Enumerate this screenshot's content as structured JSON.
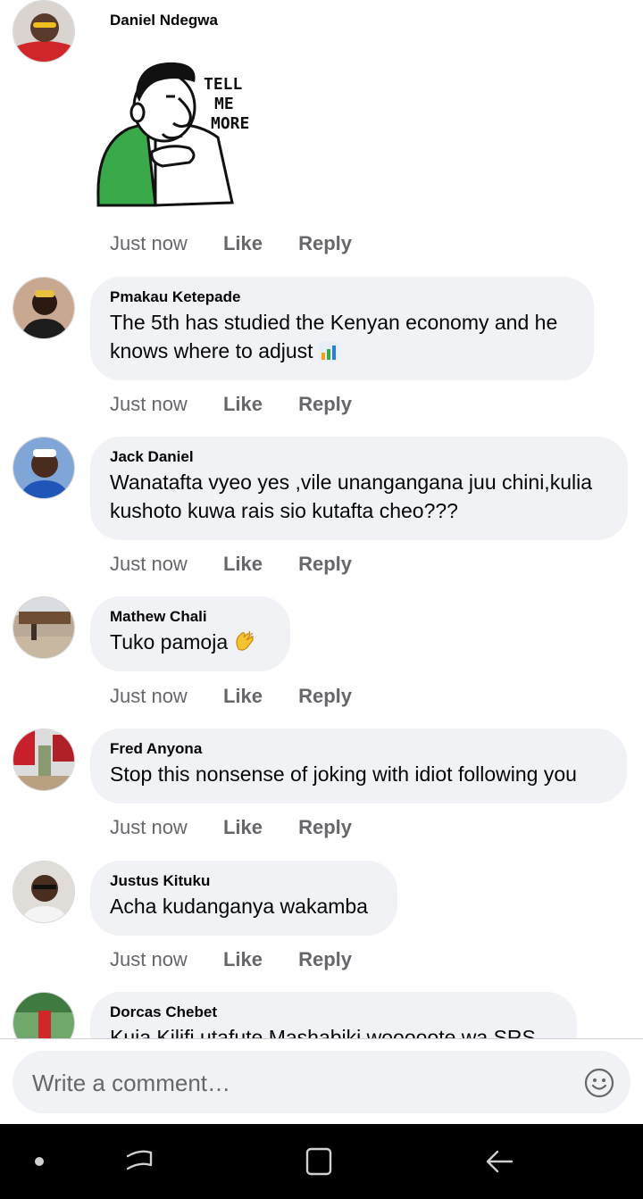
{
  "comments": [
    {
      "author": "Daniel Ndegwa",
      "sticker_text": [
        "TELL",
        "ME",
        "MORE"
      ],
      "time": "Just now",
      "like": "Like",
      "reply": "Reply"
    },
    {
      "author": "Pmakau Ketepade",
      "lines": [
        "The 5th has studied the Kenyan economy and he",
        "knows where to adjust"
      ],
      "emoji": "bar-chart-emoji",
      "time": "Just now",
      "like": "Like",
      "reply": "Reply"
    },
    {
      "author": "Jack Daniel",
      "lines": [
        "Wanatafta vyeo yes ,vile unangangana juu chini,kulia",
        "kushoto kuwa rais sio kutafta cheo???"
      ],
      "time": "Just now",
      "like": "Like",
      "reply": "Reply"
    },
    {
      "author": "Mathew Chali",
      "lines": [
        "Tuko pamoja"
      ],
      "emoji": "clapping-hands-emoji",
      "time": "Just now",
      "like": "Like",
      "reply": "Reply"
    },
    {
      "author": "Fred Anyona",
      "lines": [
        "Stop this nonsense of joking with idiot following you"
      ],
      "time": "Just now",
      "like": "Like",
      "reply": "Reply"
    },
    {
      "author": "Justus Kituku",
      "lines": [
        "Acha kudanganya wakamba"
      ],
      "time": "Just now",
      "like": "Like",
      "reply": "Reply"
    },
    {
      "author": "Dorcas Chebet",
      "lines": [
        "Kuja Kilifi utafute Mashabiki wooooote wa SRS"
      ]
    }
  ],
  "composer": {
    "placeholder": "Write a comment…",
    "icon": "smiley-icon"
  },
  "navbar": {
    "icons": [
      "dot-icon",
      "recent-apps-icon",
      "home-icon",
      "back-icon"
    ]
  },
  "colors": {
    "bubble": "#f0f2f5",
    "meta": "#65676b",
    "text": "#050505",
    "navbar": "#000000",
    "green": "#3aa94a"
  }
}
